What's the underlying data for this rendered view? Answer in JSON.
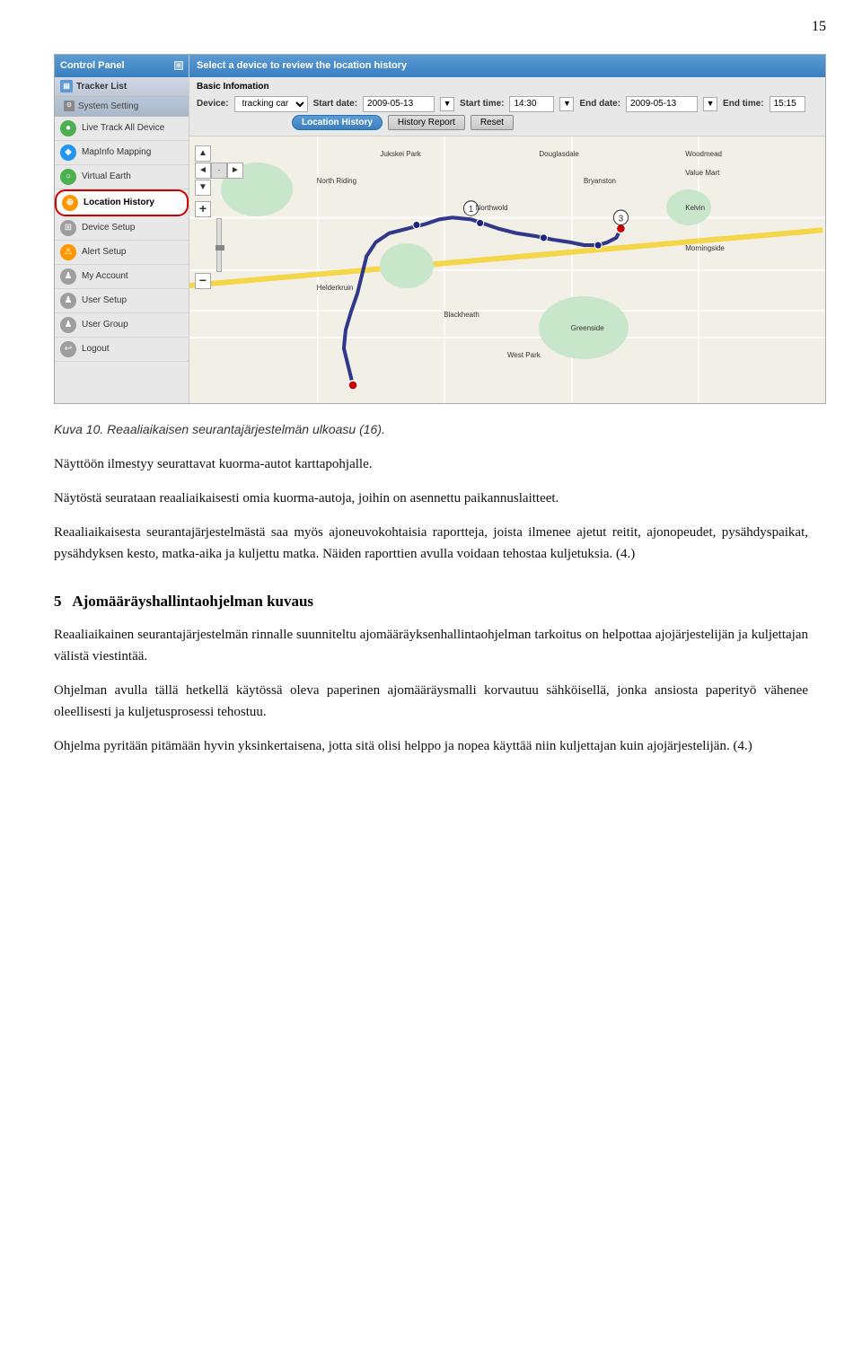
{
  "page": {
    "number": "15"
  },
  "sidebar": {
    "title": "Control Panel",
    "collapse_icon": "«",
    "tracker_list": "Tracker List",
    "system_setting": "System Setting",
    "menu_items": [
      {
        "label": "Live Track All Device",
        "icon": "●",
        "icon_class": "icon-green",
        "active": false
      },
      {
        "label": "MapInfo Mapping",
        "icon": "◆",
        "icon_class": "icon-blue",
        "active": false
      },
      {
        "label": "Virtual Earth",
        "icon": "○",
        "icon_class": "icon-green",
        "active": false
      },
      {
        "label": "Location History",
        "icon": "⊕",
        "icon_class": "icon-orange",
        "active": true
      },
      {
        "label": "Device Setup",
        "icon": "⊞",
        "icon_class": "icon-gray",
        "active": false
      },
      {
        "label": "Alert Setup",
        "icon": "⚠",
        "icon_class": "icon-orange",
        "active": false
      },
      {
        "label": "My Account",
        "icon": "♟",
        "icon_class": "icon-gray",
        "active": false
      },
      {
        "label": "User Setup",
        "icon": "♟",
        "icon_class": "icon-gray",
        "active": false
      },
      {
        "label": "User Group",
        "icon": "♟",
        "icon_class": "icon-gray",
        "active": false
      },
      {
        "label": "Logout",
        "icon": "↩",
        "icon_class": "icon-gray",
        "active": false
      }
    ]
  },
  "main_panel": {
    "top_bar_text": "Select a device to review the location history",
    "section_label": "Basic Infomation",
    "device_label": "Device:",
    "device_value": "tracking car",
    "start_date_label": "Start date:",
    "start_date_value": "2009-05-13",
    "start_time_label": "Start time:",
    "start_time_value": "14:30",
    "end_date_label": "End date:",
    "end_date_value": "2009-05-13",
    "end_time_label": "End time:",
    "end_time_value": "15:15",
    "buttons": [
      {
        "label": "Location History",
        "active": true
      },
      {
        "label": "History Report",
        "active": false
      },
      {
        "label": "Reset",
        "active": false
      }
    ]
  },
  "caption": {
    "text": "Kuva 10. Reaaliaikaisen seurantajärjestelmän ulkoasu (16)."
  },
  "paragraphs": [
    {
      "id": "p1",
      "text": "Näyttöön ilmestyy seurattavat kuorma-autot karttapohjalle."
    },
    {
      "id": "p2",
      "text": "Näytöstä seurataan reaaliaikaisesti omia kuorma-autoja, joihin on asennettu paikannuslaitteet."
    },
    {
      "id": "p3",
      "text": "Reaaliaikaisesta seurantajärjestelmästä saa myös ajoneuvokohtaisia raportteja, joista ilmenee ajetut reitit, ajonopeudet, pysähdyspaikat, pysähdyksen kesto, matka-aika ja kuljettu matka. Näiden raporttien avulla voidaan tehostaa kuljetuksia. (4.)"
    }
  ],
  "section": {
    "number": "5",
    "title": "Ajomääräyshallintaohjelman kuvaus"
  },
  "section_paragraphs": [
    {
      "id": "sp1",
      "text": "Reaaliaikainen seurantajärjestelmän rinnalle suunniteltu ajomääräyksenhallintaohjelman tarkoitus on helpottaa ajojärjestelijän ja kuljettajan välistä viestintää."
    },
    {
      "id": "sp2",
      "text": "Ohjelman avulla tällä hetkellä käytössä oleva paperinen ajomääräysmalli korvautuu sähköisellä, jonka ansiosta paperityö vähenee oleellisesti ja kuljetusprosessi tehostuu."
    },
    {
      "id": "sp3",
      "text": "Ohjelma pyritään pitämään hyvin yksinkertaisena, jotta sitä olisi helppo ja nopea käyttää niin kuljettajan kuin ajojärjestelijän. (4.)"
    }
  ]
}
